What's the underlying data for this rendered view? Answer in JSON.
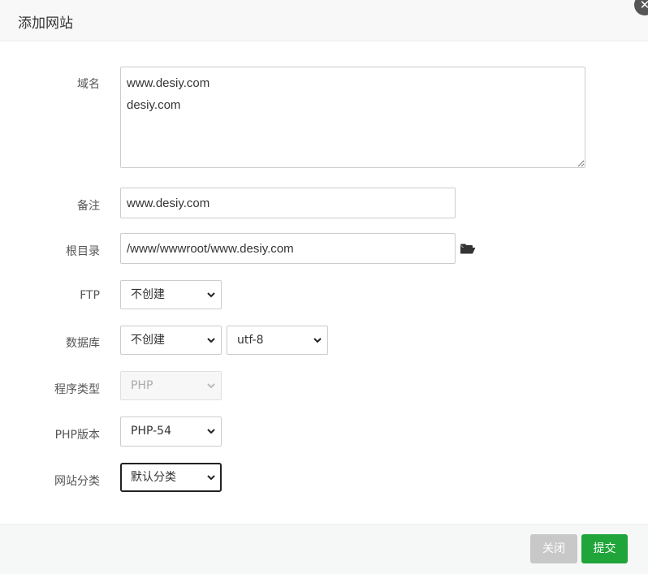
{
  "dialog": {
    "title": "添加网站",
    "close_glyph": "✕"
  },
  "form": {
    "domain": {
      "label": "域名",
      "value": "www.desiy.com\ndesiy.com"
    },
    "remark": {
      "label": "备注",
      "value": "www.desiy.com"
    },
    "root_dir": {
      "label": "根目录",
      "value": "/www/wwwroot/www.desiy.com",
      "icon": "folder-open-icon"
    },
    "ftp": {
      "label": "FTP",
      "selected": "不创建"
    },
    "database": {
      "label": "数据库",
      "selected": "不创建",
      "charset": "utf-8"
    },
    "program_type": {
      "label": "程序类型",
      "selected": "PHP",
      "disabled": true
    },
    "php_version": {
      "label": "PHP版本",
      "selected": "PHP-54"
    },
    "site_category": {
      "label": "网站分类",
      "selected": "默认分类",
      "focused": true
    }
  },
  "footer": {
    "close_label": "关闭",
    "submit_label": "提交"
  },
  "colors": {
    "submit_green": "#20a53a",
    "close_gray": "#c8c8c8"
  }
}
